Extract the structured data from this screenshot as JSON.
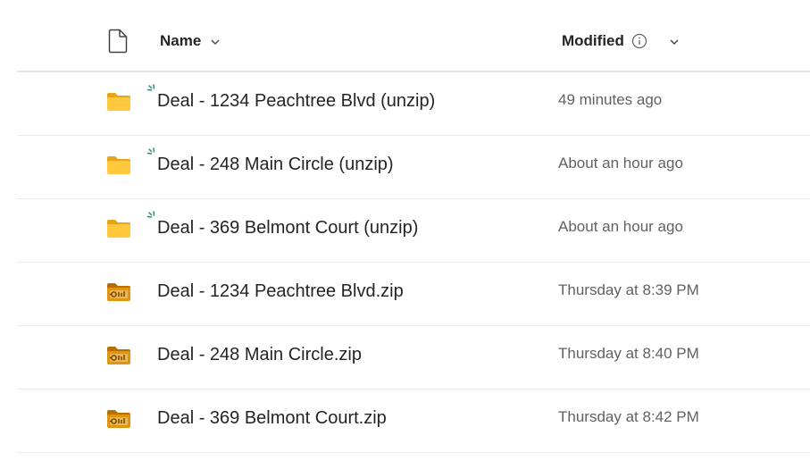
{
  "header": {
    "name_label": "Name",
    "modified_label": "Modified"
  },
  "files": [
    {
      "name": "Deal - 1234 Peachtree Blvd (unzip)",
      "modified": "49 minutes ago",
      "type": "folder",
      "is_new": true
    },
    {
      "name": "Deal - 248 Main Circle (unzip)",
      "modified": "About an hour ago",
      "type": "folder",
      "is_new": true
    },
    {
      "name": "Deal - 369 Belmont Court (unzip)",
      "modified": "About an hour ago",
      "type": "folder",
      "is_new": true
    },
    {
      "name": "Deal - 1234 Peachtree Blvd.zip",
      "modified": "Thursday at 8:39 PM",
      "type": "zip",
      "is_new": false
    },
    {
      "name": "Deal - 248 Main Circle.zip",
      "modified": "Thursday at 8:40 PM",
      "type": "zip",
      "is_new": false
    },
    {
      "name": "Deal - 369 Belmont Court.zip",
      "modified": "Thursday at 8:42 PM",
      "type": "zip",
      "is_new": false
    }
  ],
  "icons": {
    "file_type_header": "document-icon",
    "folder": "folder-icon",
    "zip": "zip-folder-icon",
    "new_badge": "new-item-sparkle-icon",
    "info": "info-icon",
    "sort": "chevron-down-icon"
  },
  "colors": {
    "folder": "#ffc83d",
    "folder_back": "#e8a317",
    "zip": "#d88a0a",
    "new_badge": "#2e8b7a",
    "divider": "#ebebeb"
  }
}
